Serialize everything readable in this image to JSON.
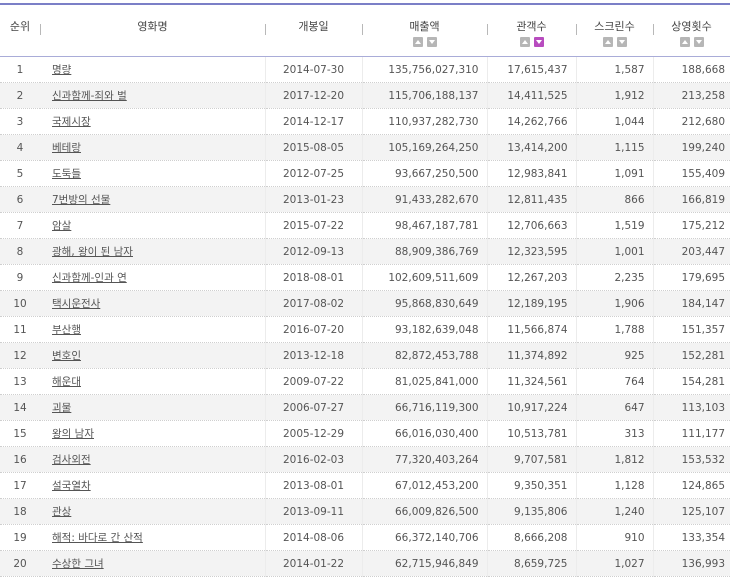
{
  "table": {
    "headers": [
      "순위",
      "영화명",
      "개봉일",
      "매출액",
      "관객수",
      "스크린수",
      "상영횟수"
    ],
    "sort_active": {
      "column": "관객수",
      "direction": "descending",
      "color": "#b84cbf"
    },
    "rows": [
      {
        "rank": "1",
        "title": "명량",
        "release_date": "2014-07-30",
        "revenue": "135,756,027,310",
        "audience": "17,615,437",
        "screens": "1,587",
        "showings": "188,668"
      },
      {
        "rank": "2",
        "title": "신과함께-죄와 벌",
        "release_date": "2017-12-20",
        "revenue": "115,706,188,137",
        "audience": "14,411,525",
        "screens": "1,912",
        "showings": "213,258"
      },
      {
        "rank": "3",
        "title": "국제시장",
        "release_date": "2014-12-17",
        "revenue": "110,937,282,730",
        "audience": "14,262,766",
        "screens": "1,044",
        "showings": "212,680"
      },
      {
        "rank": "4",
        "title": "베테랑",
        "release_date": "2015-08-05",
        "revenue": "105,169,264,250",
        "audience": "13,414,200",
        "screens": "1,115",
        "showings": "199,240"
      },
      {
        "rank": "5",
        "title": "도둑들",
        "release_date": "2012-07-25",
        "revenue": "93,667,250,500",
        "audience": "12,983,841",
        "screens": "1,091",
        "showings": "155,409"
      },
      {
        "rank": "6",
        "title": "7번방의 선물",
        "release_date": "2013-01-23",
        "revenue": "91,433,282,670",
        "audience": "12,811,435",
        "screens": "866",
        "showings": "166,819"
      },
      {
        "rank": "7",
        "title": "암살",
        "release_date": "2015-07-22",
        "revenue": "98,467,187,781",
        "audience": "12,706,663",
        "screens": "1,519",
        "showings": "175,212"
      },
      {
        "rank": "8",
        "title": "광해, 왕이 된 남자",
        "release_date": "2012-09-13",
        "revenue": "88,909,386,769",
        "audience": "12,323,595",
        "screens": "1,001",
        "showings": "203,447"
      },
      {
        "rank": "9",
        "title": "신과함께-인과 연",
        "release_date": "2018-08-01",
        "revenue": "102,609,511,609",
        "audience": "12,267,203",
        "screens": "2,235",
        "showings": "179,695"
      },
      {
        "rank": "10",
        "title": "택시운전사",
        "release_date": "2017-08-02",
        "revenue": "95,868,830,649",
        "audience": "12,189,195",
        "screens": "1,906",
        "showings": "184,147"
      },
      {
        "rank": "11",
        "title": "부산행",
        "release_date": "2016-07-20",
        "revenue": "93,182,639,048",
        "audience": "11,566,874",
        "screens": "1,788",
        "showings": "151,357"
      },
      {
        "rank": "12",
        "title": "변호인",
        "release_date": "2013-12-18",
        "revenue": "82,872,453,788",
        "audience": "11,374,892",
        "screens": "925",
        "showings": "152,281"
      },
      {
        "rank": "13",
        "title": "해운대",
        "release_date": "2009-07-22",
        "revenue": "81,025,841,000",
        "audience": "11,324,561",
        "screens": "764",
        "showings": "154,281"
      },
      {
        "rank": "14",
        "title": "괴물",
        "release_date": "2006-07-27",
        "revenue": "66,716,119,300",
        "audience": "10,917,224",
        "screens": "647",
        "showings": "113,103"
      },
      {
        "rank": "15",
        "title": "왕의 남자",
        "release_date": "2005-12-29",
        "revenue": "66,016,030,400",
        "audience": "10,513,781",
        "screens": "313",
        "showings": "111,177"
      },
      {
        "rank": "16",
        "title": "검사외전",
        "release_date": "2016-02-03",
        "revenue": "77,320,403,264",
        "audience": "9,707,581",
        "screens": "1,812",
        "showings": "153,532"
      },
      {
        "rank": "17",
        "title": "설국열차",
        "release_date": "2013-08-01",
        "revenue": "67,012,453,200",
        "audience": "9,350,351",
        "screens": "1,128",
        "showings": "124,865"
      },
      {
        "rank": "18",
        "title": "관상",
        "release_date": "2013-09-11",
        "revenue": "66,009,826,500",
        "audience": "9,135,806",
        "screens": "1,240",
        "showings": "125,107"
      },
      {
        "rank": "19",
        "title": "해적: 바다로 간 산적",
        "release_date": "2014-08-06",
        "revenue": "66,372,140,706",
        "audience": "8,666,208",
        "screens": "910",
        "showings": "133,354"
      },
      {
        "rank": "20",
        "title": "수상한 그녀",
        "release_date": "2014-01-22",
        "revenue": "62,715,946,849",
        "audience": "8,659,725",
        "screens": "1,027",
        "showings": "136,993"
      }
    ]
  }
}
